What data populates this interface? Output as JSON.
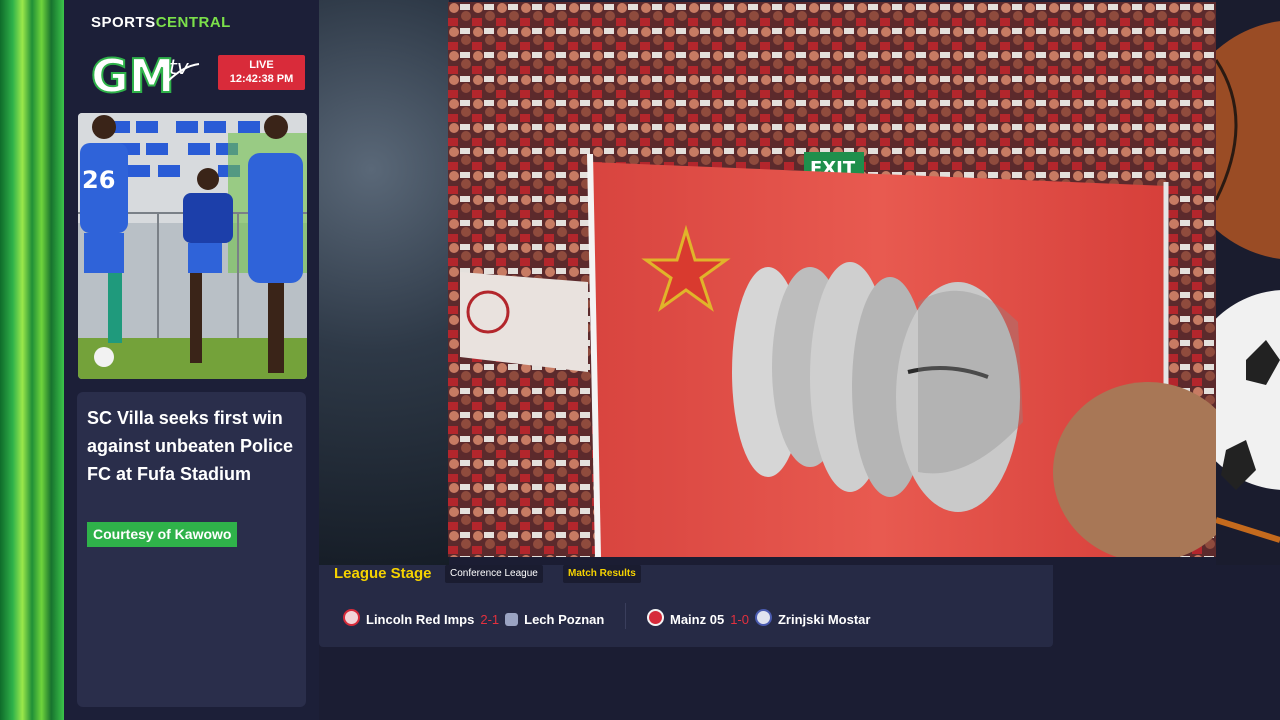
{
  "sidebar": {
    "brand": {
      "part1": "SPORTS",
      "part2": "CENTRAL"
    },
    "logo": {
      "text": "GM",
      "suffix": "tv"
    },
    "live": {
      "label": "LIVE",
      "time": "12:42:38 PM"
    },
    "photo": {
      "jersey_number": "26"
    },
    "article": {
      "headline": "SC Villa seeks first win against unbeaten Police FC at Fufa Stadium",
      "credit": "Courtesy of Kawowo"
    }
  },
  "video": {
    "exit_sign": "EXIT"
  },
  "scores": {
    "title": "League Stage",
    "competition": "Conference League",
    "section": "Match Results",
    "matches": [
      {
        "home": "Lincoln Red Imps",
        "score": "2-1",
        "away": "Lech Poznan"
      },
      {
        "home": "Mainz 05",
        "score": "1-0",
        "away": "Zrinjski Mostar"
      }
    ]
  },
  "colors": {
    "accent_green": "#2fb24a",
    "live_red": "#d92b3a",
    "highlight_yellow": "#f5d200",
    "score_red": "#e2303e"
  }
}
